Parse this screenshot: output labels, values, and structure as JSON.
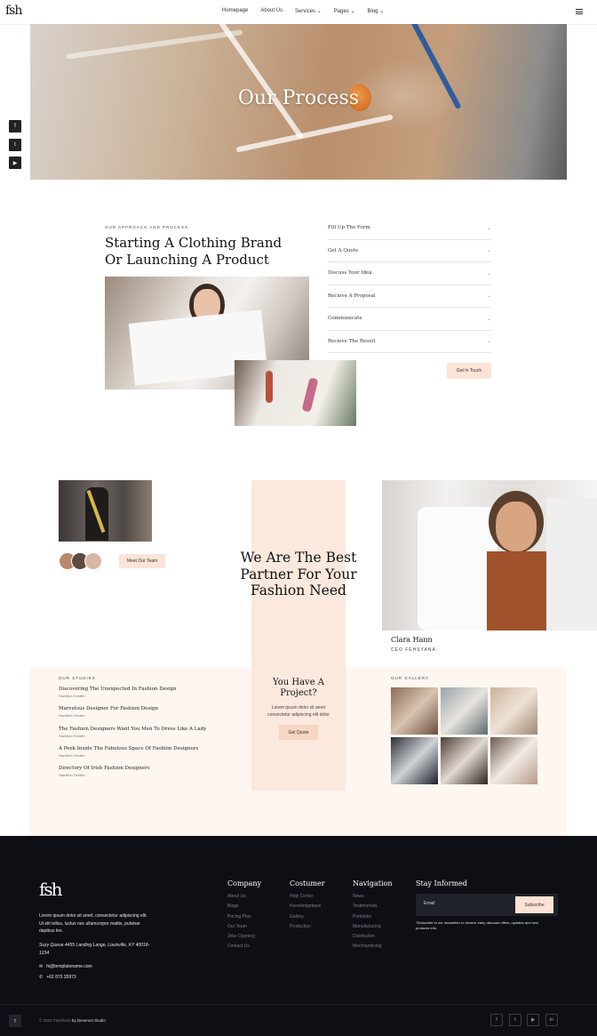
{
  "header": {
    "logo": "fsh",
    "nav": [
      "Homepage",
      "About Us",
      "Services",
      "Pages",
      "Blog"
    ],
    "nav_dropdowns": [
      false,
      false,
      true,
      true,
      true
    ]
  },
  "social_side": [
    "facebook-icon",
    "twitter-icon",
    "youtube-icon"
  ],
  "hero": {
    "title": "Our Process"
  },
  "process": {
    "eyebrow": "OUR APPROACH AND PROCESS",
    "title_line1": "Starting A Clothing Brand",
    "title_line2": "Or Launching A Product",
    "faq": [
      "Fill Up The Form",
      "Get A Quote",
      "Discuss Your Idea",
      "Recieve A Proposal",
      "Communicate",
      "Recieve The Result"
    ],
    "cta": "Get In Touch"
  },
  "partner": {
    "meet_team": "Meet Our Team",
    "title_line1": "We Are The Best",
    "title_line2": "Partner For Your",
    "title_line3": "Fashion Need",
    "person_name": "Clara Hann",
    "person_role": "CEO FEHSYANA"
  },
  "studies": {
    "eyebrow": "OUR STUDIES",
    "items": [
      {
        "title": "Discovering The Unexpected In Fashion Design",
        "author": "Hamilton Serafin"
      },
      {
        "title": "Marvelous Designer For Fashion Design",
        "author": "Hamilton Serafin"
      },
      {
        "title": "The Fashion Designers Want You Men To Dress Like A Lady",
        "author": "Hamilton Serafin"
      },
      {
        "title": "A Peek Inside The Fabulous Space Of Fashion Designers",
        "author": "Hamilton Serafin"
      },
      {
        "title": "Directory Of Irish Fashion Designers",
        "author": "Hamilton Serafin"
      }
    ]
  },
  "quote": {
    "title_line1": "You Have A",
    "title_line2": "Project?",
    "text_line1": "Lorem ipsum dolor sit amet",
    "text_line2": "consectetur adipiscing elit dolor",
    "button": "Get Quote"
  },
  "gallery": {
    "eyebrow": "OUR GALLERY"
  },
  "footer": {
    "about_line1": "Lorem ipsum dolor sit amet, consectetur adipiscing elit.",
    "about_line2": "Ut elit tellus, luctus nec ullamcorper mattis, pulvinar",
    "about_line3": "dapibus leo.",
    "address_line1": "Suzy Queue 4455 Landing Lange, Louisville, KY 40018-",
    "address_line2": "1234",
    "email": "hi@templatename.com",
    "phone": "+62 873 35973",
    "columns": [
      {
        "title": "Company",
        "items": [
          "About Us",
          "Blogs",
          "Pricing Plan",
          "Our Team",
          "Jobs Opening",
          "Contact Us"
        ]
      },
      {
        "title": "Costumer",
        "items": [
          "Help Center",
          "Knowledgebase",
          "Gallery",
          "Production"
        ]
      },
      {
        "title": "Navigation",
        "items": [
          "News",
          "Testimonials",
          "Portofolio",
          "Manufacturing",
          "Distribution",
          "Merchandising"
        ]
      }
    ],
    "newsletter": {
      "title": "Stay Informed",
      "placeholder": "Email",
      "button": "Subscribe",
      "note_line1": "*Subscribe to our newsletter to receive early discount offers, updates and new",
      "note_line2": "products info."
    },
    "copyright_pre": "© 2022 Feyshana",
    "copyright_by": "by Deverust Studio",
    "social": [
      "facebook-icon",
      "twitter-icon",
      "youtube-icon",
      "linkedin-icon"
    ]
  },
  "colors": {
    "accent": "#fbe4d6",
    "dark": "#0d0f15",
    "cream": "#fdf6f1"
  }
}
